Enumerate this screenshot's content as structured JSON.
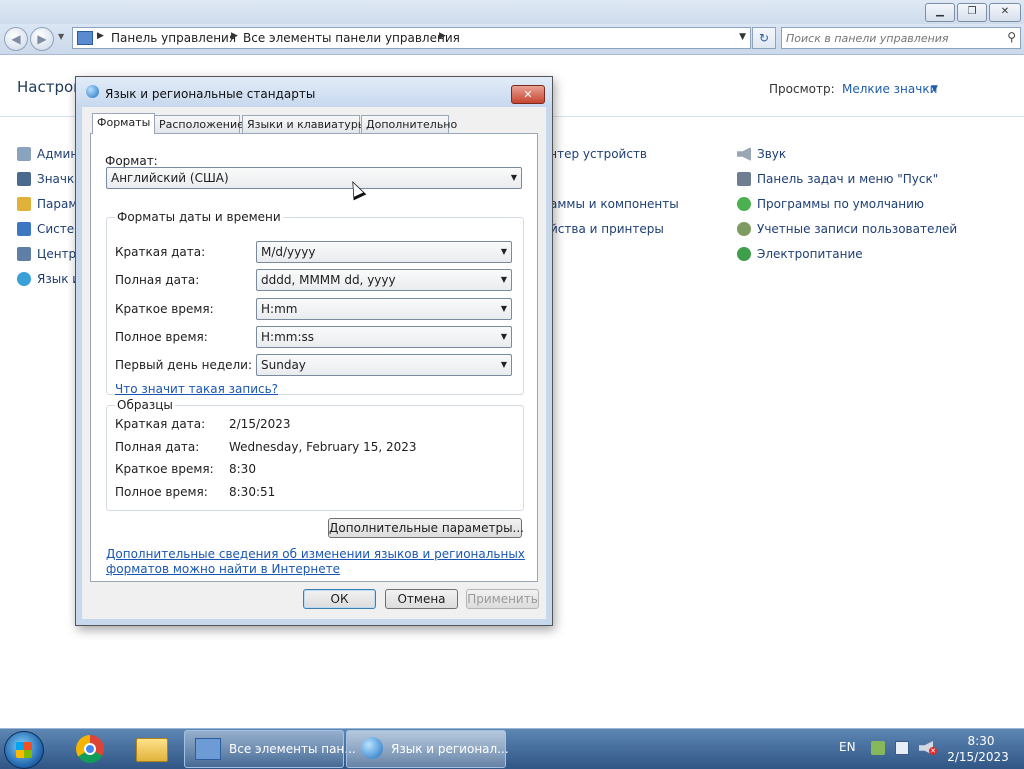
{
  "control_panel": {
    "breadcrumb": [
      "Панель управления",
      "Все элементы панели управления"
    ],
    "search_placeholder": "Поиск в панели управления",
    "heading": "Настрой",
    "view_label": "Просмотр:",
    "view_value": "Мелкие значки",
    "items_col1": [
      "Админ",
      "Значк",
      "Парам",
      "Систе",
      "Центр",
      "Язык и"
    ],
    "items_col2": [
      "чтер устройств",
      "",
      "аммы и компоненты",
      "йства и принтеры"
    ],
    "items_col3": [
      "Звук",
      "Панель задач и меню \"Пуск\"",
      "Программы по умолчанию",
      "Учетные записи пользователей",
      "Электропитание"
    ]
  },
  "dialog": {
    "title": "Язык и региональные стандарты",
    "tabs": [
      "Форматы",
      "Расположение",
      "Языки и клавиатуры",
      "Дополнительно"
    ],
    "format_label": "Формат:",
    "format_value": "Английский (США)",
    "group_formats_title": "Форматы даты и времени",
    "format_rows": [
      {
        "label": "Краткая дата:",
        "value": "M/d/yyyy"
      },
      {
        "label": "Полная дата:",
        "value": "dddd, MMMM dd, yyyy"
      },
      {
        "label": "Краткое время:",
        "value": "H:mm"
      },
      {
        "label": "Полное время:",
        "value": "H:mm:ss"
      },
      {
        "label": "Первый день недели:",
        "value": "Sunday"
      }
    ],
    "help_link": "Что значит такая запись?",
    "group_samples_title": "Образцы",
    "samples": [
      {
        "label": "Краткая дата:",
        "value": "2/15/2023"
      },
      {
        "label": "Полная дата:",
        "value": "Wednesday, February 15, 2023"
      },
      {
        "label": "Краткое время:",
        "value": "8:30"
      },
      {
        "label": "Полное время:",
        "value": "8:30:51"
      }
    ],
    "additional_button": "Дополнительные параметры...",
    "online_link_line1": "Дополнительные сведения об изменении языков и региональных",
    "online_link_line2": "форматов можно найти в Интернете",
    "ok": "ОК",
    "cancel": "Отмена",
    "apply": "Применить"
  },
  "taskbar": {
    "task_cp": "Все элементы пан...",
    "task_region": "Язык и регионал...",
    "lang": "EN",
    "time": "8:30",
    "date": "2/15/2023"
  }
}
